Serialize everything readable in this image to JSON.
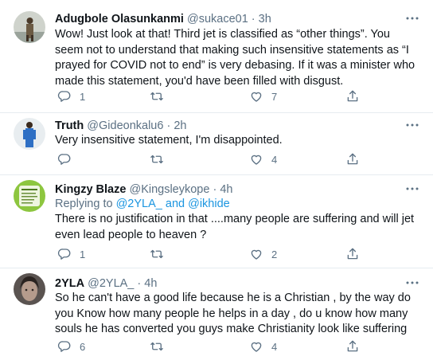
{
  "tweets": [
    {
      "name": "Adugbole Olasunkanmi",
      "handle": "@sukace01",
      "separator": "·",
      "time": "3h",
      "reply_prefix": "",
      "reply_mentions": [],
      "text": "Wow! Just look at that! Third jet is classified as “other things”. You seem not to understand that making such insensitive statements as “I prayed for COVID not to end” is very debasing. If it was a minister who made this statement, you'd have been filled with disgust.",
      "reply_count": "1",
      "retweet_count": "",
      "like_count": "7",
      "avatar_icon": "avatar-man-standing"
    },
    {
      "name": "Truth",
      "handle": "@Gideonkalu6",
      "separator": "·",
      "time": "2h",
      "reply_prefix": "",
      "reply_mentions": [],
      "text": "Very insensitive statement, I'm disappointed.",
      "reply_count": "",
      "retweet_count": "",
      "like_count": "4",
      "avatar_icon": "avatar-man-blue-outfit"
    },
    {
      "name": "Kingzy Blaze",
      "handle": "@Kingsleykope",
      "separator": "·",
      "time": "4h",
      "reply_prefix": "Replying to",
      "reply_mentions": [
        "@2YLA_",
        "and",
        "@ikhide"
      ],
      "text": "There is no justification in that ....many people are suffering and will jet even lead people to heaven ?",
      "reply_count": "1",
      "retweet_count": "",
      "like_count": "2",
      "avatar_icon": "avatar-green-poster"
    },
    {
      "name": "2YLA",
      "handle": "@2YLA_",
      "separator": "·",
      "time": "4h",
      "reply_prefix": "",
      "reply_mentions": [],
      "text": "So he can't have a good life because he is a Christian , by the way do you Know how many people he helps in a day , do u know how many souls he has converted you guys make Christianity look like suffering",
      "reply_count": "6",
      "retweet_count": "",
      "like_count": "4",
      "avatar_icon": "avatar-woman-portrait"
    }
  ],
  "icons": {
    "reply": "reply-icon",
    "retweet": "retweet-icon",
    "like": "like-icon",
    "share": "share-icon",
    "more": "more-icon"
  },
  "colors": {
    "muted": "#5b7083",
    "link": "#1b95e0",
    "divider": "#e6ecf0",
    "text": "#0f1419"
  }
}
